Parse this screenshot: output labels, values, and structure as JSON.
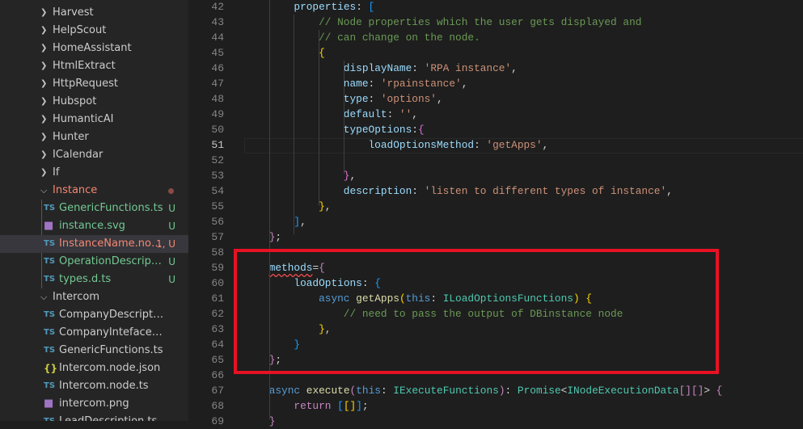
{
  "sidebar": {
    "items": [
      {
        "type": "folder",
        "label": "Harvest"
      },
      {
        "type": "folder",
        "label": "HelpScout"
      },
      {
        "type": "folder",
        "label": "HomeAssistant"
      },
      {
        "type": "folder",
        "label": "HtmlExtract"
      },
      {
        "type": "folder",
        "label": "HttpRequest"
      },
      {
        "type": "folder",
        "label": "Hubspot"
      },
      {
        "type": "folder",
        "label": "HumanticAI"
      },
      {
        "type": "folder",
        "label": "Hunter"
      },
      {
        "type": "folder",
        "label": "ICalendar"
      },
      {
        "type": "folder",
        "label": "If"
      },
      {
        "type": "folder-open",
        "label": "Instance",
        "status": "red",
        "dot": true
      },
      {
        "type": "file",
        "icon": "TS",
        "label": "GenericFunctions.ts",
        "badge": "U",
        "status": "green"
      },
      {
        "type": "file",
        "icon": "svg",
        "label": "instance.svg",
        "badge": "U",
        "status": "green"
      },
      {
        "type": "file",
        "icon": "TS",
        "label": "InstanceName.nod...",
        "badge": "1, U",
        "status": "red",
        "selected": true
      },
      {
        "type": "file",
        "icon": "TS",
        "label": "OperationDescriptio...",
        "badge": "U",
        "status": "green"
      },
      {
        "type": "file",
        "icon": "TS",
        "label": "types.d.ts",
        "badge": "U",
        "status": "green"
      },
      {
        "type": "folder-open",
        "label": "Intercom"
      },
      {
        "type": "file",
        "icon": "TS",
        "label": "CompanyDescription.ts"
      },
      {
        "type": "file",
        "icon": "TS",
        "label": "CompanyInteface.ts"
      },
      {
        "type": "file",
        "icon": "TS",
        "label": "GenericFunctions.ts"
      },
      {
        "type": "file",
        "icon": "{}",
        "label": "Intercom.node.json"
      },
      {
        "type": "file",
        "icon": "TS",
        "label": "Intercom.node.ts"
      },
      {
        "type": "file",
        "icon": "png",
        "label": "intercom.png"
      },
      {
        "type": "file",
        "icon": "TS",
        "label": "LeadDescription.ts"
      }
    ]
  },
  "editor": {
    "current_line": 51,
    "lines": [
      {
        "n": 42,
        "i": 2,
        "t": [
          [
            "properties",
            "p"
          ],
          [
            ": ",
            "w"
          ],
          [
            "[",
            "b3"
          ]
        ]
      },
      {
        "n": 43,
        "i": 3,
        "t": [
          [
            "// Node properties which the user gets displayed and",
            "cm"
          ]
        ]
      },
      {
        "n": 44,
        "i": 3,
        "t": [
          [
            "// can change on the node.",
            "cm"
          ]
        ]
      },
      {
        "n": 45,
        "i": 3,
        "t": [
          [
            "{",
            "b1"
          ]
        ]
      },
      {
        "n": 46,
        "i": 4,
        "t": [
          [
            "displayName",
            "p"
          ],
          [
            ": ",
            "w"
          ],
          [
            "'RPA instance'",
            "s"
          ],
          [
            ",",
            "w"
          ]
        ]
      },
      {
        "n": 47,
        "i": 4,
        "t": [
          [
            "name",
            "p"
          ],
          [
            ": ",
            "w"
          ],
          [
            "'rpainstance'",
            "s"
          ],
          [
            ",",
            "w"
          ]
        ]
      },
      {
        "n": 48,
        "i": 4,
        "t": [
          [
            "type",
            "p"
          ],
          [
            ": ",
            "w"
          ],
          [
            "'options'",
            "s"
          ],
          [
            ",",
            "w"
          ]
        ]
      },
      {
        "n": 49,
        "i": 4,
        "t": [
          [
            "default",
            "p"
          ],
          [
            ": ",
            "w"
          ],
          [
            "''",
            "s"
          ],
          [
            ",",
            "w"
          ]
        ]
      },
      {
        "n": 50,
        "i": 4,
        "t": [
          [
            "typeOptions",
            "p"
          ],
          [
            ":",
            "w"
          ],
          [
            "{",
            "b2"
          ]
        ]
      },
      {
        "n": 51,
        "i": 5,
        "t": [
          [
            "loadOptionsMethod",
            "p"
          ],
          [
            ": ",
            "w"
          ],
          [
            "'getApps'",
            "s"
          ],
          [
            ",",
            "w"
          ]
        ]
      },
      {
        "n": 52,
        "i": 0,
        "t": []
      },
      {
        "n": 53,
        "i": 4,
        "t": [
          [
            "}",
            "b2"
          ],
          [
            ",",
            "w"
          ]
        ]
      },
      {
        "n": 54,
        "i": 4,
        "t": [
          [
            "description",
            "p"
          ],
          [
            ": ",
            "w"
          ],
          [
            "'listen to different types of instance'",
            "s"
          ],
          [
            ",",
            "w"
          ]
        ]
      },
      {
        "n": 55,
        "i": 3,
        "t": [
          [
            "}",
            "b1"
          ],
          [
            ",",
            "w"
          ]
        ]
      },
      {
        "n": 56,
        "i": 2,
        "t": [
          [
            "]",
            "b3"
          ],
          [
            ",",
            "w"
          ]
        ]
      },
      {
        "n": 57,
        "i": 1,
        "t": [
          [
            "}",
            "c"
          ],
          [
            ";",
            "w"
          ]
        ]
      },
      {
        "n": 58,
        "i": 0,
        "t": []
      },
      {
        "n": 59,
        "i": 1,
        "t": [
          [
            "methods",
            "p sq"
          ],
          [
            "=",
            "w"
          ],
          [
            "{",
            "c"
          ]
        ]
      },
      {
        "n": 60,
        "i": 2,
        "t": [
          [
            "loadOptions",
            "p"
          ],
          [
            ": ",
            "w"
          ],
          [
            "{",
            "b3"
          ]
        ]
      },
      {
        "n": 61,
        "i": 3,
        "t": [
          [
            "async ",
            "k"
          ],
          [
            "getApps",
            "f"
          ],
          [
            "(",
            "b1"
          ],
          [
            "this",
            "k"
          ],
          [
            ": ",
            "w"
          ],
          [
            "ILoadOptionsFunctions",
            "t"
          ],
          [
            ")",
            "b1"
          ],
          [
            " ",
            "w"
          ],
          [
            "{",
            "b1"
          ]
        ]
      },
      {
        "n": 62,
        "i": 4,
        "t": [
          [
            "// need to pass the output of DBinstance node",
            "cm"
          ]
        ]
      },
      {
        "n": 63,
        "i": 3,
        "t": [
          [
            "}",
            "b1"
          ],
          [
            ",",
            "w"
          ]
        ]
      },
      {
        "n": 64,
        "i": 2,
        "t": [
          [
            "}",
            "b3"
          ]
        ]
      },
      {
        "n": 65,
        "i": 1,
        "t": [
          [
            "}",
            "c"
          ],
          [
            ";",
            "w"
          ]
        ]
      },
      {
        "n": 66,
        "i": 0,
        "t": []
      },
      {
        "n": 67,
        "i": 1,
        "t": [
          [
            "async ",
            "k"
          ],
          [
            "execute",
            "f"
          ],
          [
            "(",
            "c"
          ],
          [
            "this",
            "k"
          ],
          [
            ": ",
            "w"
          ],
          [
            "IExecuteFunctions",
            "t"
          ],
          [
            ")",
            "c"
          ],
          [
            ": ",
            "w"
          ],
          [
            "Promise",
            "t"
          ],
          [
            "<",
            "w"
          ],
          [
            "INodeExecutionData",
            "t"
          ],
          [
            "[]",
            "c"
          ],
          [
            "[]",
            "c"
          ],
          [
            "> ",
            "w"
          ],
          [
            "{",
            "c"
          ]
        ]
      },
      {
        "n": 68,
        "i": 2,
        "t": [
          [
            "return ",
            "c"
          ],
          [
            "[",
            "b3"
          ],
          [
            "[]",
            "b1"
          ],
          [
            "]",
            "b3"
          ],
          [
            ";",
            "w"
          ]
        ]
      },
      {
        "n": 69,
        "i": 1,
        "t": [
          [
            "}",
            "c"
          ]
        ]
      }
    ]
  },
  "colors": {
    "highlight": "#e81123"
  }
}
